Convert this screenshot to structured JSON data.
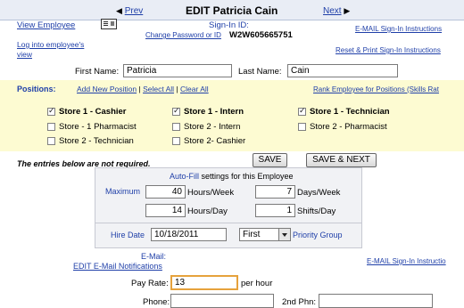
{
  "header": {
    "prev_label": "Prev",
    "title": "EDIT Patricia Cain",
    "next_label": "Next"
  },
  "left_links": {
    "view_employee": "View Employee",
    "log_into": "Log into employee's view"
  },
  "signin": {
    "label": "Sign-In ID:",
    "change_link": "Change Password or ID",
    "id_value": "W2W605665751"
  },
  "right_links": {
    "email_instructions": "E-MAIL Sign-In Instructions",
    "reset_print": "Reset & Print Sign-In Instructions"
  },
  "name": {
    "first_label": "First Name:",
    "first_value": "Patricia",
    "last_label": "Last Name:",
    "last_value": "Cain"
  },
  "positions": {
    "label": "Positions:",
    "add_new": "Add New Position",
    "select_all": "Select All",
    "clear_all": "Clear All",
    "rank": "Rank Employee for Positions (Skills Rat",
    "items": [
      {
        "label": "Store 1 - Cashier",
        "checked": true
      },
      {
        "label": "Store 1 - Intern",
        "checked": true
      },
      {
        "label": "Store 1 - Technician",
        "checked": true
      },
      {
        "label": "Store - 1 Pharmacist",
        "checked": false
      },
      {
        "label": "Store 2 - Intern",
        "checked": false
      },
      {
        "label": "Store 2 - Pharmacist",
        "checked": false
      },
      {
        "label": "Store 2 - Technician",
        "checked": false
      },
      {
        "label": "Store 2- Cashier",
        "checked": false
      }
    ]
  },
  "form": {
    "not_required": "The entries below are not required.",
    "save": "SAVE",
    "save_next": "SAVE & NEXT"
  },
  "autofill": {
    "link": "Auto-Fill",
    "rest": " settings for this Employee",
    "maximum": "Maximum",
    "hours_week_value": "40",
    "hours_week_label": "Hours/Week",
    "days_week_value": "7",
    "days_week_label": "Days/Week",
    "hours_day_value": "14",
    "hours_day_label": "Hours/Day",
    "shifts_day_value": "1",
    "shifts_day_label": "Shifts/Day",
    "hire_date_label": "Hire Date",
    "hire_date_value": "10/18/2011",
    "priority_value": "First",
    "priority_label": "Priority Group"
  },
  "email": {
    "label": "E-Mail:",
    "edit_notifications": "EDIT E-Mail Notifications",
    "signin_instructions": "E-MAIL Sign-In Instructio"
  },
  "pay": {
    "label": "Pay Rate:",
    "value": "13",
    "unit": "per hour"
  },
  "phone": {
    "label": "Phone:",
    "value": "",
    "label2": "2nd Phn:",
    "value2": ""
  }
}
